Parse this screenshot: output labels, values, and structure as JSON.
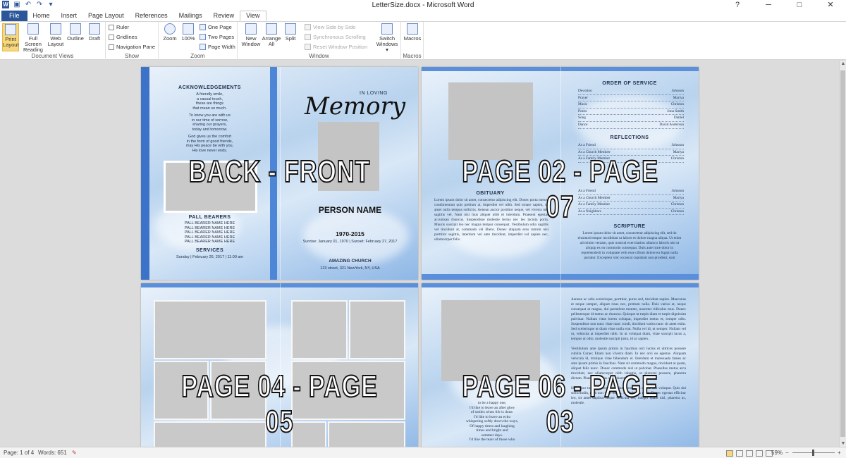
{
  "window": {
    "title": "LetterSize.docx  -  Microsoft Word",
    "minimize": "─",
    "restore": "□",
    "close": "✕",
    "help": "?"
  },
  "quick_access": [
    "word-icon",
    "save-icon",
    "undo-icon",
    "redo-icon",
    "customize-icon"
  ],
  "tabs": [
    "File",
    "Home",
    "Insert",
    "Page Layout",
    "References",
    "Mailings",
    "Review",
    "View"
  ],
  "active_tab": "View",
  "ribbon": {
    "document_views": {
      "label": "Document Views",
      "print_layout": "Print Layout",
      "full_screen_reading": "Full Screen Reading",
      "web_layout": "Web Layout",
      "outline": "Outline",
      "draft": "Draft"
    },
    "show": {
      "label": "Show",
      "ruler": "Ruler",
      "gridlines": "Gridlines",
      "navigation_pane": "Navigation Pane"
    },
    "zoom": {
      "label": "Zoom",
      "zoom": "Zoom",
      "hundred": "100%",
      "one_page": "One Page",
      "two_pages": "Two Pages",
      "page_width": "Page Width"
    },
    "window": {
      "label": "Window",
      "new_window": "New Window",
      "arrange_all": "Arrange All",
      "split": "Split",
      "view_side_by_side": "View Side by Side",
      "synchronous_scrolling": "Synchronous Scrolling",
      "reset_window_position": "Reset Window Position",
      "switch_windows": "Switch Windows ▾"
    },
    "macros": {
      "label": "Macros",
      "macros": "Macros"
    }
  },
  "pages": {
    "p1": {
      "overlay": "BACK - FRONT",
      "ack_title": "ACKNOWLEDGEMENTS",
      "ack_text": [
        "A friendly smile,",
        "a casual touch,",
        "these are things",
        "that mean so much.",
        "",
        "To know you are with us",
        "in our time of sorrow,",
        "sharing our prayers,",
        "today and tomorrow.",
        "",
        "God gives us the comfort",
        "in the form of good friends,",
        "may His peace be with you,",
        "His love never ends."
      ],
      "pall_title": "PALL BEARERS",
      "pall_items": [
        "PALL BEARER NAME HERE",
        "PALL BEARER NAME HERE",
        "PALL BEARER NAME HERE",
        "PALL BEARER NAME HERE",
        "PALL BEARER NAME HERE"
      ],
      "services_title": "SERVICES",
      "services_text": "Sunday | February 26, 2017 | 11:00 am",
      "in_loving": "IN LOVING",
      "memory": "Memory",
      "person_name": "PERSON NAME",
      "years": "1970-2015",
      "dates": "Sunrise: January 01, 1970 | Sunset: February 27, 2017",
      "church": "AMAZING CHURCH",
      "address": "123 street, 321 NewYork, NY, USA"
    },
    "p2": {
      "overlay": "PAGE 02 - PAGE 07",
      "obituary_title": "OBITUARY",
      "obituary_text": "Lorem ipsum dolor sit amet, consectetur adipiscing elit. Donec porta metus, condimentum quis pretium at, imperdiet vel nibh. Sed ornare sapien, sit amet nulla tempus sollicitu. Aenean auctor porttitor neque, vel viverra nisl sagittis vel. Nam nisi mus aliquet nibh et interdum. Praesent egestas accumsan rhoncus. Suspendisse molestie lectus nec leo lacinia porta. Mauris suscipit leo nec magna tempor consequat. Vestibulum odio sagittis vel tincidunt at, commodo vel libero. Donec aliquam eros rutrum nisi porttitor sagittis, interdum vel ante tincidunt, imperdiet vel sapien nec, ullamcorper felis.",
      "order_title": "ORDER OF SERVICE",
      "order": [
        [
          "Devotion",
          "Johnson"
        ],
        [
          "Prayer",
          "Mariya"
        ],
        [
          "Music",
          "Christon"
        ],
        [
          "Poem",
          "Jona Smith"
        ],
        [
          "Song",
          "Daniel"
        ],
        [
          "Dance",
          "David Anderson"
        ]
      ],
      "reflections_title": "REFLECTIONS",
      "reflections": [
        [
          "As a Friend",
          "Johnson"
        ],
        [
          "As a Church Member",
          "Mariya"
        ],
        [
          "As a Family Member",
          "Christon"
        ]
      ],
      "second_list": [
        [
          "As a Friend",
          "Johnson"
        ],
        [
          "As a Church Member",
          "Mariya"
        ],
        [
          "As a Family Member",
          "Christon"
        ],
        [
          "As a Neighbors",
          "Christon"
        ]
      ],
      "scripture_title": "SCRIPTURE",
      "scripture_text": "Lorem ipsum dolor sit amet, consectetur adipiscing elit, sed do eiusmod tempor incididunt ut labore et dolore magna aliqua. Ut enim ad minim veniam, quis nostrud exercitation ullamco laboris nisi ut aliquip ex ea commodo consequat. Duis aute irure dolor in reprehenderit in voluptate velit esse cillum dolore eu fugiat nulla pariatur. Excepteur sint occaecat cupidatat non proident, sunt"
    },
    "p3": {
      "overlay": "PAGE 04 - PAGE 05"
    },
    "p4": {
      "overlay": "PAGE 06 - PAGE 03",
      "right_text": "Aenean ac odio scelerisque, porttitor, purus sed, tincidunt sapien. Maecenas et neque semper, aliquet risus nec, pretium nulla. Duis varius at, neque consequat at magna, dui parturient montes, nascetur ridiculus mus. Donec pellentesque id metus ac rhoncus. Quisque ut turpis diam et turpis dignissim pulvinar. Nullam vitae lorem volutpat, imperdiet metus et, semper odio. Suspendisse non nunc vitae nunc condi, tincidunt varius nunc sit amet enim. Sed scelerisque ut diam vitae nulla erat. Nulla vel id, ut semper. Nullam vel ut, vehicula at imperdiet nibh. In ut volutpat diam, vitae suscipit lacus a, tempus ut odio, molestie suscipit justo, id ac sapien.\n\nVestibulum ante ipsum primis in faucibus orci luctus et ultrices posuere cubilia Curae; Etiam non viverra diam. In nec orci eu egestas. Aliquam vehicula id, tristique vitae bibendum et. Interdum et malesuada fames ac ante ipsum primis in faucibus. Nam sit commodo magna, tincidunt at quam, aliquet felis nunc. Donec commodo nisl ut pulvinar. Phasellus metus arcu tincidunt, nec ullamcorper nibh lobortis, ut placerat posuere, pharetra dictum. Phasellus metus arcu pharetra at.\n\nId tempor turpis eleifend ut. Etiam commodo a ante sed volutpat. Quis dui sollicitudin, nibh non velit luctus, sed lobortis risus. Donec egestas efficitur leo, sit amet dapibus neque vehicula vel, integer quam nisl, pharetra ac, molestie.",
      "poem": [
        "to be a happy one,",
        "I'd like to leave an after glow",
        "of smiles when life is done.",
        "I'd like to leave an echo",
        "whispering softly down the ways,",
        "Of happy times and laughing",
        "times and bright and",
        "summer days.",
        "I'd like the tears of those who"
      ]
    }
  },
  "status": {
    "page": "Page: 1 of 4",
    "words": "Words: 651",
    "zoom_pct": "59%",
    "zoom_minus": "−",
    "zoom_plus": "+"
  },
  "zoom_level": 0.59
}
